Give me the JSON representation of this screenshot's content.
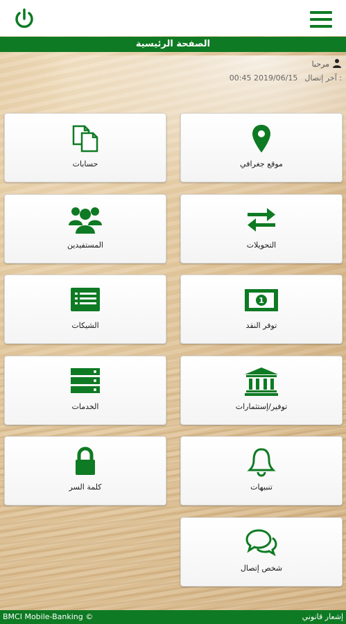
{
  "header": {
    "power_icon": "power-icon",
    "menu_icon": "hamburger-menu-icon",
    "title": "الصفحة الرئيسية"
  },
  "user": {
    "greeting": "مرحبا",
    "last_connection_label": "آخر إتصال :",
    "last_connection_value": "00:45 2019/06/15"
  },
  "tiles": [
    {
      "label": "حسابات",
      "icon": "documents-icon"
    },
    {
      "label": "موقع جغرافي",
      "icon": "map-marker-icon"
    },
    {
      "label": "المستفيدين",
      "icon": "users-icon"
    },
    {
      "label": "التحويلات",
      "icon": "transfer-arrows-icon"
    },
    {
      "label": "الشيكات",
      "icon": "list-icon"
    },
    {
      "label": "توفر النقد",
      "icon": "banknote-icon"
    },
    {
      "label": "الخدمات",
      "icon": "server-icon"
    },
    {
      "label": "توفير/إستثمارات",
      "icon": "bank-icon"
    },
    {
      "label": "كلمة السر",
      "icon": "lock-icon"
    },
    {
      "label": "تنبيهات",
      "icon": "bell-icon"
    },
    {
      "label": "شخص إتصال",
      "icon": "chat-icon"
    }
  ],
  "footer": {
    "copyright": "BMCI Mobile-Banking ©",
    "legal": "إشعار قانوني"
  },
  "colors": {
    "brand_green": "#0e7a23",
    "tile_bg": "#ffffff"
  }
}
